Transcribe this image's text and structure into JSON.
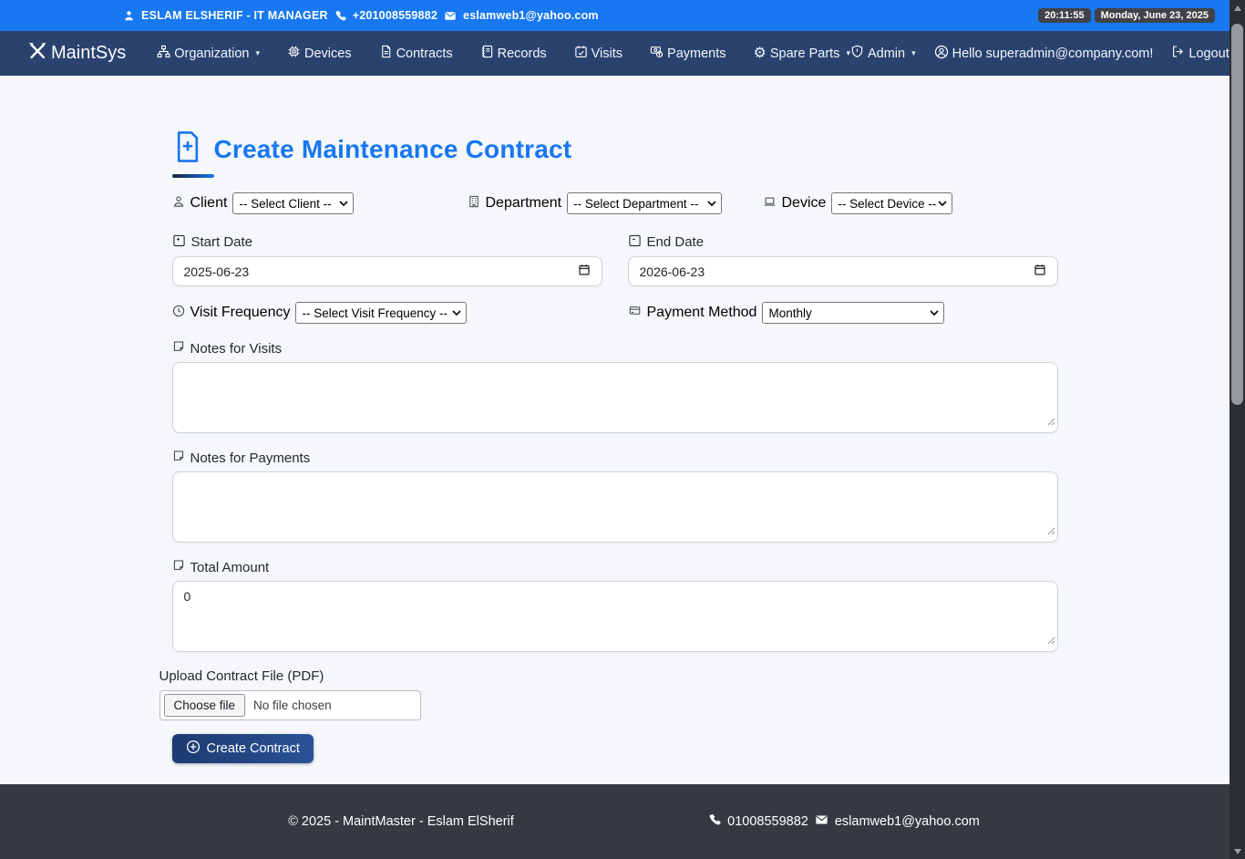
{
  "topbar": {
    "user": "ESLAM ELSHERIF - IT MANAGER",
    "phone": "+201008559882",
    "email": "eslamweb1@yahoo.com",
    "time": "20:11:55",
    "date": "Monday, June 23, 2025"
  },
  "navbar": {
    "brand": "MaintSys",
    "organization": "Organization",
    "devices": "Devices",
    "contracts": "Contracts",
    "records": "Records",
    "visits": "Visits",
    "payments": "Payments",
    "spare_parts": "Spare Parts",
    "admin": "Admin",
    "greeting": "Hello superadmin@company.com!",
    "logout": "Logout"
  },
  "form": {
    "title": "Create Maintenance Contract",
    "client": {
      "label": "Client",
      "value": "-- Select Client --"
    },
    "department": {
      "label": "Department",
      "value": "-- Select Department --"
    },
    "device": {
      "label": "Device",
      "value": "-- Select Device --"
    },
    "start_date": {
      "label": "Start Date",
      "value": "2025-06-23"
    },
    "end_date": {
      "label": "End Date",
      "value": "2026-06-23"
    },
    "visit_frequency": {
      "label": "Visit Frequency",
      "value": "-- Select Visit Frequency --"
    },
    "payment_method": {
      "label": "Payment Method",
      "value": "Monthly"
    },
    "notes_visits": {
      "label": "Notes for Visits",
      "value": ""
    },
    "notes_payments": {
      "label": "Notes for Payments",
      "value": ""
    },
    "total_amount": {
      "label": "Total Amount",
      "value": "0"
    },
    "upload": {
      "label": "Upload Contract File (PDF)",
      "button": "Choose file",
      "status": "No file chosen"
    },
    "submit": "Create Contract"
  },
  "footer": {
    "copyright": "© 2025 - MaintMaster - Eslam ElSherif",
    "phone": "01008559882",
    "email": "eslamweb1@yahoo.com"
  },
  "colors": {
    "topbar_blue": "#1778f2",
    "navbar_navy": "#2a426e",
    "title_blue": "#1877f2",
    "button_gradient_start": "#1d3b6f",
    "button_gradient_end": "#2a5298",
    "footer_dark": "#343a40",
    "page_background": "#f5f7fa"
  }
}
